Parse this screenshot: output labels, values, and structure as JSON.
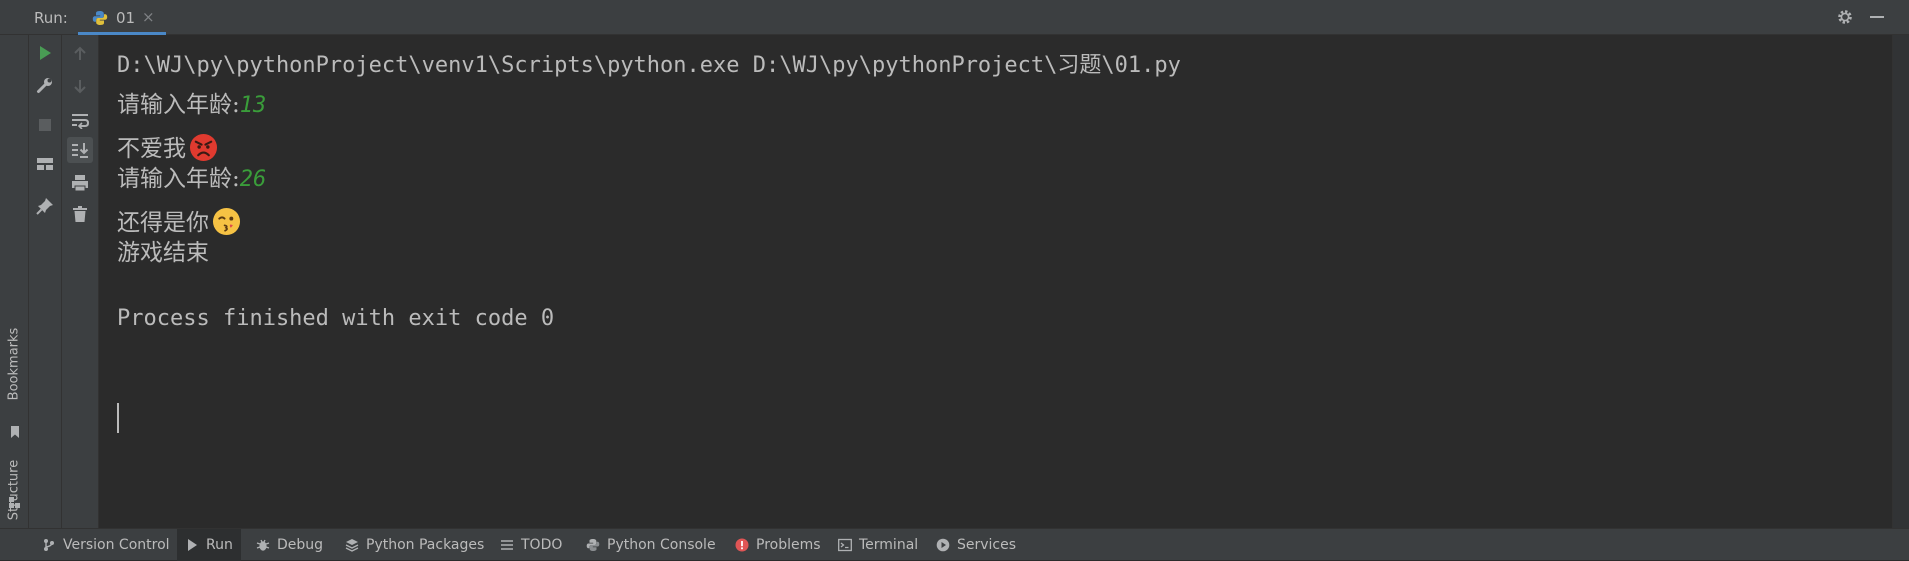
{
  "header": {
    "run_label": "Run:",
    "tab_label": "01",
    "tab_close": "×"
  },
  "left_stripe": {
    "items": [
      {
        "label": "Bookmarks"
      },
      {
        "label": "Structure"
      }
    ]
  },
  "toolbar1": {
    "icons": [
      "rerun-icon",
      "wrench-icon",
      "stop-icon",
      "layout-icon",
      "pin-icon"
    ]
  },
  "toolbar2": {
    "icons": [
      "up-arrow-icon",
      "down-arrow-icon",
      "soft-wrap-icon",
      "scroll-to-end-icon",
      "print-icon",
      "trash-icon"
    ]
  },
  "console": {
    "command": "D:\\WJ\\py\\pythonProject\\venv1\\Scripts\\python.exe D:\\WJ\\py\\pythonProject\\习题\\01.py",
    "prompt1": "请输入年龄:",
    "input1": "13",
    "reply1": "不爱我",
    "reply1_emoji": "angry-face-emoji",
    "prompt2": "请输入年龄:",
    "input2": "26",
    "reply2": "还得是你",
    "reply2_emoji": "kissing-wink-face-emoji",
    "end_text": "游戏结束",
    "exit_message": "Process finished with exit code 0"
  },
  "bottom_bar": {
    "items": [
      {
        "label": "Version Control",
        "icon": "branch-icon"
      },
      {
        "label": "Run",
        "icon": "play-icon",
        "active": true
      },
      {
        "label": "Debug",
        "icon": "bug-icon"
      },
      {
        "label": "Python Packages",
        "icon": "layers-icon"
      },
      {
        "label": "TODO",
        "icon": "list-icon"
      },
      {
        "label": "Python Console",
        "icon": "python-icon"
      },
      {
        "label": "Problems",
        "icon": "error-icon"
      },
      {
        "label": "Terminal",
        "icon": "terminal-icon"
      },
      {
        "label": "Services",
        "icon": "services-icon"
      }
    ]
  },
  "colors": {
    "background": "#2b2b2b",
    "panel": "#3c3f41",
    "text": "#bbbbbb",
    "user_input": "#3a9d3a",
    "run_green": "#499c54",
    "accent_tab": "#4a88c7",
    "error_red": "#e05555"
  }
}
